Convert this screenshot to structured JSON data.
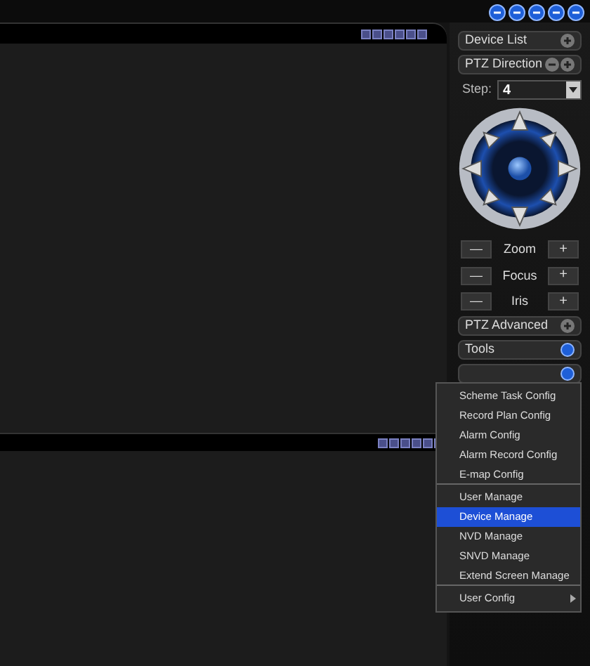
{
  "panels": [
    {
      "title": "Device List",
      "buttons": [
        {
          "kind": "plus"
        }
      ]
    },
    {
      "title": "PTZ Direction",
      "buttons": [
        {
          "kind": "minus"
        },
        {
          "kind": "plus"
        }
      ]
    }
  ],
  "step": {
    "label": "Step:",
    "value": "4"
  },
  "ptz_controls": [
    {
      "label": "Zoom",
      "minus": "—",
      "plus": "+"
    },
    {
      "label": "Focus",
      "minus": "—",
      "plus": "+"
    },
    {
      "label": "Iris",
      "minus": "—",
      "plus": "+"
    }
  ],
  "lower_panels": [
    {
      "title": "PTZ Advanced",
      "kind": "plain"
    },
    {
      "title": "Tools",
      "kind": "active"
    },
    {
      "kind": "active"
    }
  ],
  "context_menu": [
    {
      "label": "Scheme Task Config",
      "selected": false,
      "submenu": false,
      "divider_after": false
    },
    {
      "label": "Record Plan Config",
      "selected": false,
      "submenu": false,
      "divider_after": false
    },
    {
      "label": "Alarm Config",
      "selected": false,
      "submenu": false,
      "divider_after": false
    },
    {
      "label": "Alarm Record Config",
      "selected": false,
      "submenu": false,
      "divider_after": false
    },
    {
      "label": "E-map Config",
      "selected": false,
      "submenu": false,
      "divider_after": true
    },
    {
      "label": "User Manage",
      "selected": false,
      "submenu": false,
      "divider_after": false
    },
    {
      "label": "Device Manage",
      "selected": true,
      "submenu": false,
      "divider_after": false
    },
    {
      "label": "NVD Manage",
      "selected": false,
      "submenu": false,
      "divider_after": false
    },
    {
      "label": "SNVD Manage",
      "selected": false,
      "submenu": false,
      "divider_after": false
    },
    {
      "label": "Extend Screen Manage",
      "selected": false,
      "submenu": false,
      "divider_after": true
    },
    {
      "label": "User Config",
      "selected": false,
      "submenu": true,
      "divider_after": false
    }
  ]
}
